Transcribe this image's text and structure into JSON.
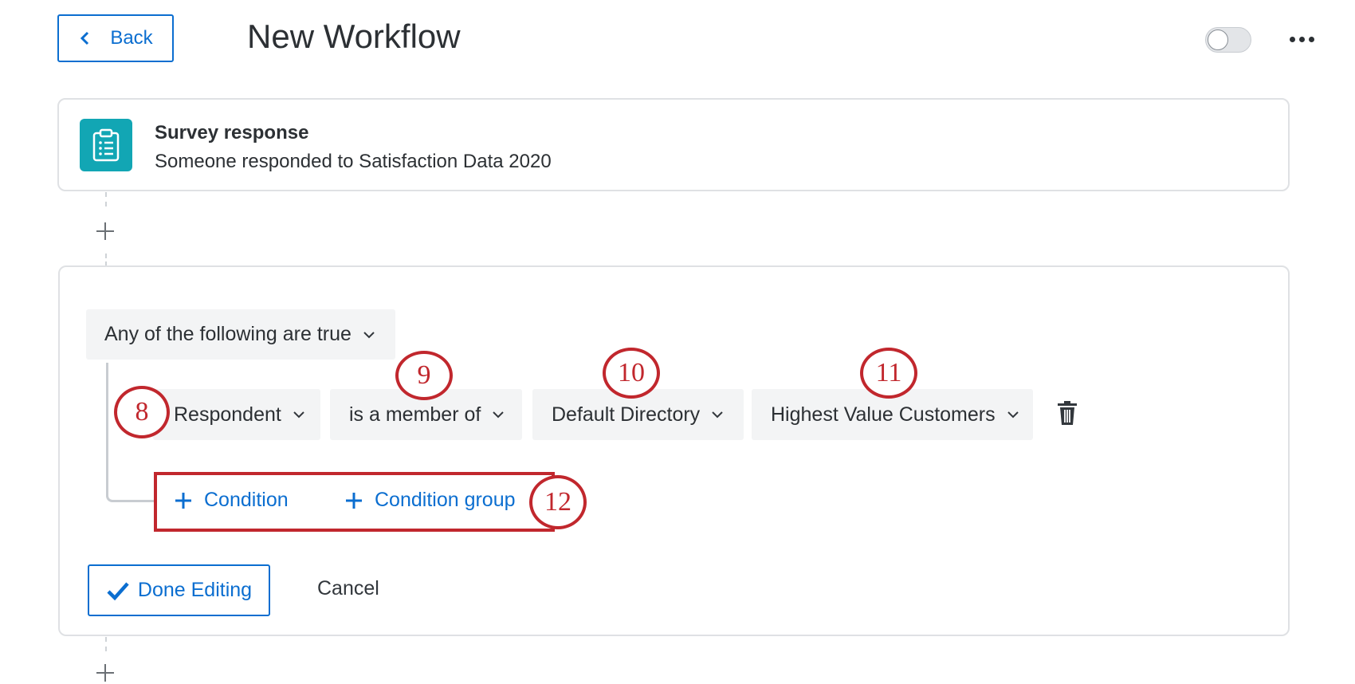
{
  "header": {
    "back_label": "Back",
    "title": "New Workflow",
    "toggle_state": "off"
  },
  "trigger": {
    "title": "Survey response",
    "description": "Someone responded to Satisfaction Data 2020",
    "icon": "clipboard-list-icon"
  },
  "conditions": {
    "group_selector": "Any of the following are true",
    "row": {
      "field": "Respondent",
      "operator": "is a member of",
      "directory": "Default Directory",
      "list": "Highest Value Customers"
    },
    "add_condition_label": "Condition",
    "add_group_label": "Condition group"
  },
  "actions": {
    "done_label": "Done Editing",
    "cancel_label": "Cancel"
  },
  "callouts": {
    "field": "8",
    "operator": "9",
    "directory": "10",
    "list": "11",
    "add_buttons": "12"
  },
  "colors": {
    "accent": "#0b6ed0",
    "trigger_icon_bg": "#12a6b4",
    "callout": "#c1272d",
    "dropdown_bg": "#f3f4f5"
  }
}
